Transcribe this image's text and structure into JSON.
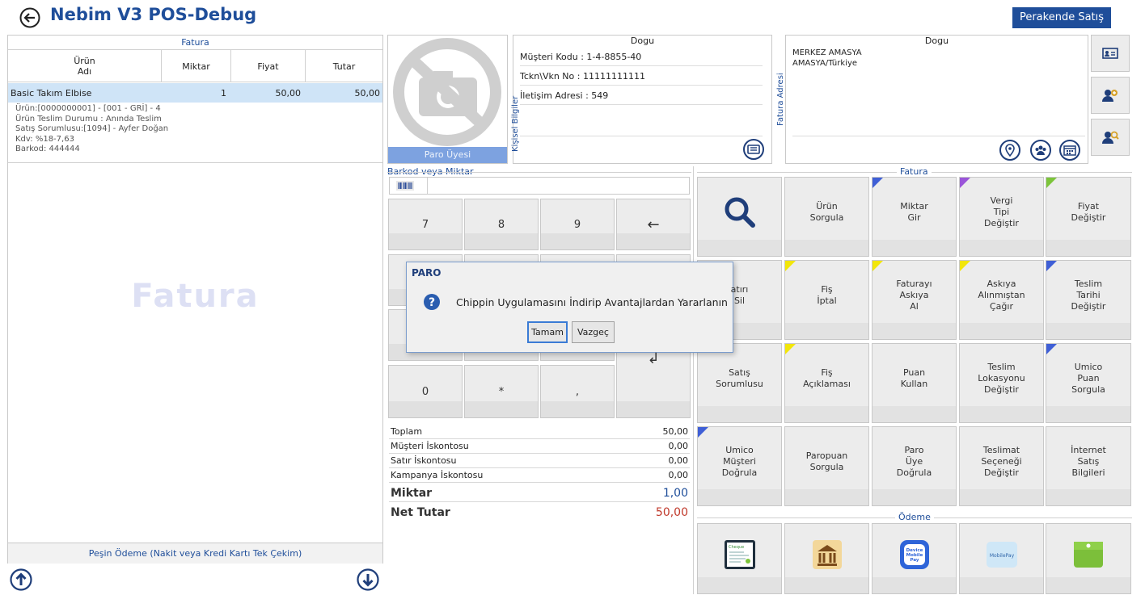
{
  "app": {
    "title": "Nebim V3 POS-Debug",
    "mode_button": "Perakende Satış"
  },
  "invoice": {
    "header": "Fatura",
    "columns": {
      "product": "Ürün\nAdı",
      "qty": "Miktar",
      "price": "Fiyat",
      "total": "Tutar"
    },
    "row": {
      "name": "Basic Takım Elbise",
      "qty": "1",
      "price": "50,00",
      "total": "50,00"
    },
    "details": [
      "Ürün:[0000000001] - [001 - GRİ] - 4",
      "Ürün Teslim Durumu : Anında Teslim",
      "Satış Sorumlusu:[1094] - Ayfer Doğan",
      "Kdv: %18-7,63",
      "Barkod: 444444"
    ],
    "watermark": "Fatura",
    "payment_label": "Peşin Ödeme (Nakit veya Kredi Kartı Tek Çekim)"
  },
  "customer": {
    "photo_label": "Paro Üyesi",
    "name": "Dogu",
    "personal_tab": "Kişisel Bilgiler",
    "customer_code": "Müşteri Kodu : 1-4-8855-40",
    "tax_no": "Tckn\\Vkn No : 11111111111",
    "contact_address": "İletişim Adresi : 549",
    "invoice_addr_tab": "Fatura Adresi",
    "invoice_name": "Dogu",
    "addr_line1": "MERKEZ AMASYA",
    "addr_line2": "AMASYA/Türkiye"
  },
  "keypad": {
    "label": "Barkod veya Miktar",
    "input_value": "",
    "keys_row1": [
      "7",
      "8",
      "9",
      "←"
    ],
    "keys_row4": [
      "0",
      "*",
      ","
    ],
    "enter": "↲"
  },
  "totals": {
    "rows": [
      {
        "label": "Toplam",
        "value": "50,00"
      },
      {
        "label": "Müşteri İskontosu",
        "value": "0,00"
      },
      {
        "label": "Satır İskontosu",
        "value": "0,00"
      },
      {
        "label": "Kampanya İskontosu",
        "value": "0,00"
      }
    ],
    "qty_label": "Miktar",
    "qty_value": "1,00",
    "net_label": "Net Tutar",
    "net_value": "50,00"
  },
  "functions": {
    "header": "Fatura",
    "buttons": [
      "",
      "Ürün\nSorgula",
      "Miktar\nGir",
      "Vergi\nTipi\nDeğiştir",
      "Fiyat\nDeğiştir",
      "atırı\nSil",
      "Fiş\nİptal",
      "Faturayı\nAskıya\nAl",
      "Askıya\nAlınmıştan\nÇağır",
      "Teslim\nTarihi\nDeğiştir",
      "Satış\nSorumlusu",
      "Fiş\nAçıklaması",
      "Puan\nKullan",
      "Teslim\nLokasyonu\nDeğiştir",
      "Umico\nPuan\nSorgula",
      "Umico\nMüşteri\nDoğrula",
      "Paropuan\nSorgula",
      "Paro\nÜye\nDoğrula",
      "Teslimat\nSeçeneği\nDeğiştir",
      "İnternet\nSatış\nBilgileri"
    ]
  },
  "payment": {
    "header": "Ödeme",
    "device_pay": "Device\nMobile\nPay",
    "mobile_pay": "MobilePay",
    "cheque": "Cheque"
  },
  "dialog": {
    "title": "PARO",
    "message": "Chippin Uygulamasını İndirip Avantajlardan Yararlanın",
    "ok": "Tamam",
    "cancel": "Vazgeç"
  },
  "colors": {
    "brand": "#1f4e9a",
    "net": "#c0392b",
    "selected_row": "#cfe4f7"
  }
}
